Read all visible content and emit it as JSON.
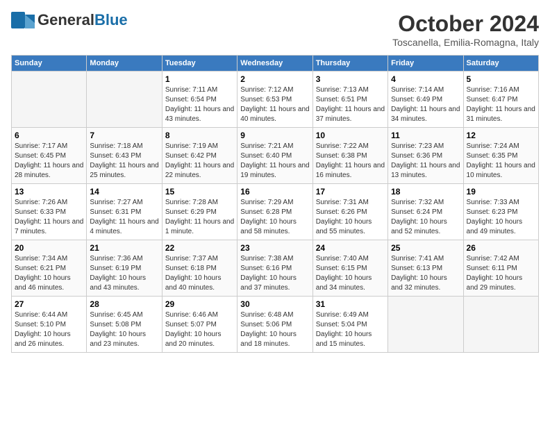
{
  "logo": {
    "general": "General",
    "blue": "Blue"
  },
  "title": "October 2024",
  "location": "Toscanella, Emilia-Romagna, Italy",
  "weekdays": [
    "Sunday",
    "Monday",
    "Tuesday",
    "Wednesday",
    "Thursday",
    "Friday",
    "Saturday"
  ],
  "weeks": [
    [
      {
        "day": "",
        "empty": true
      },
      {
        "day": "",
        "empty": true
      },
      {
        "day": "1",
        "sunrise": "7:11 AM",
        "sunset": "6:54 PM",
        "daylight": "11 hours and 43 minutes."
      },
      {
        "day": "2",
        "sunrise": "7:12 AM",
        "sunset": "6:53 PM",
        "daylight": "11 hours and 40 minutes."
      },
      {
        "day": "3",
        "sunrise": "7:13 AM",
        "sunset": "6:51 PM",
        "daylight": "11 hours and 37 minutes."
      },
      {
        "day": "4",
        "sunrise": "7:14 AM",
        "sunset": "6:49 PM",
        "daylight": "11 hours and 34 minutes."
      },
      {
        "day": "5",
        "sunrise": "7:16 AM",
        "sunset": "6:47 PM",
        "daylight": "11 hours and 31 minutes."
      }
    ],
    [
      {
        "day": "6",
        "sunrise": "7:17 AM",
        "sunset": "6:45 PM",
        "daylight": "11 hours and 28 minutes."
      },
      {
        "day": "7",
        "sunrise": "7:18 AM",
        "sunset": "6:43 PM",
        "daylight": "11 hours and 25 minutes."
      },
      {
        "day": "8",
        "sunrise": "7:19 AM",
        "sunset": "6:42 PM",
        "daylight": "11 hours and 22 minutes."
      },
      {
        "day": "9",
        "sunrise": "7:21 AM",
        "sunset": "6:40 PM",
        "daylight": "11 hours and 19 minutes."
      },
      {
        "day": "10",
        "sunrise": "7:22 AM",
        "sunset": "6:38 PM",
        "daylight": "11 hours and 16 minutes."
      },
      {
        "day": "11",
        "sunrise": "7:23 AM",
        "sunset": "6:36 PM",
        "daylight": "11 hours and 13 minutes."
      },
      {
        "day": "12",
        "sunrise": "7:24 AM",
        "sunset": "6:35 PM",
        "daylight": "11 hours and 10 minutes."
      }
    ],
    [
      {
        "day": "13",
        "sunrise": "7:26 AM",
        "sunset": "6:33 PM",
        "daylight": "11 hours and 7 minutes."
      },
      {
        "day": "14",
        "sunrise": "7:27 AM",
        "sunset": "6:31 PM",
        "daylight": "11 hours and 4 minutes."
      },
      {
        "day": "15",
        "sunrise": "7:28 AM",
        "sunset": "6:29 PM",
        "daylight": "11 hours and 1 minute."
      },
      {
        "day": "16",
        "sunrise": "7:29 AM",
        "sunset": "6:28 PM",
        "daylight": "10 hours and 58 minutes."
      },
      {
        "day": "17",
        "sunrise": "7:31 AM",
        "sunset": "6:26 PM",
        "daylight": "10 hours and 55 minutes."
      },
      {
        "day": "18",
        "sunrise": "7:32 AM",
        "sunset": "6:24 PM",
        "daylight": "10 hours and 52 minutes."
      },
      {
        "day": "19",
        "sunrise": "7:33 AM",
        "sunset": "6:23 PM",
        "daylight": "10 hours and 49 minutes."
      }
    ],
    [
      {
        "day": "20",
        "sunrise": "7:34 AM",
        "sunset": "6:21 PM",
        "daylight": "10 hours and 46 minutes."
      },
      {
        "day": "21",
        "sunrise": "7:36 AM",
        "sunset": "6:19 PM",
        "daylight": "10 hours and 43 minutes."
      },
      {
        "day": "22",
        "sunrise": "7:37 AM",
        "sunset": "6:18 PM",
        "daylight": "10 hours and 40 minutes."
      },
      {
        "day": "23",
        "sunrise": "7:38 AM",
        "sunset": "6:16 PM",
        "daylight": "10 hours and 37 minutes."
      },
      {
        "day": "24",
        "sunrise": "7:40 AM",
        "sunset": "6:15 PM",
        "daylight": "10 hours and 34 minutes."
      },
      {
        "day": "25",
        "sunrise": "7:41 AM",
        "sunset": "6:13 PM",
        "daylight": "10 hours and 32 minutes."
      },
      {
        "day": "26",
        "sunrise": "7:42 AM",
        "sunset": "6:11 PM",
        "daylight": "10 hours and 29 minutes."
      }
    ],
    [
      {
        "day": "27",
        "sunrise": "6:44 AM",
        "sunset": "5:10 PM",
        "daylight": "10 hours and 26 minutes."
      },
      {
        "day": "28",
        "sunrise": "6:45 AM",
        "sunset": "5:08 PM",
        "daylight": "10 hours and 23 minutes."
      },
      {
        "day": "29",
        "sunrise": "6:46 AM",
        "sunset": "5:07 PM",
        "daylight": "10 hours and 20 minutes."
      },
      {
        "day": "30",
        "sunrise": "6:48 AM",
        "sunset": "5:06 PM",
        "daylight": "10 hours and 18 minutes."
      },
      {
        "day": "31",
        "sunrise": "6:49 AM",
        "sunset": "5:04 PM",
        "daylight": "10 hours and 15 minutes."
      },
      {
        "day": "",
        "empty": true
      },
      {
        "day": "",
        "empty": true
      }
    ]
  ]
}
